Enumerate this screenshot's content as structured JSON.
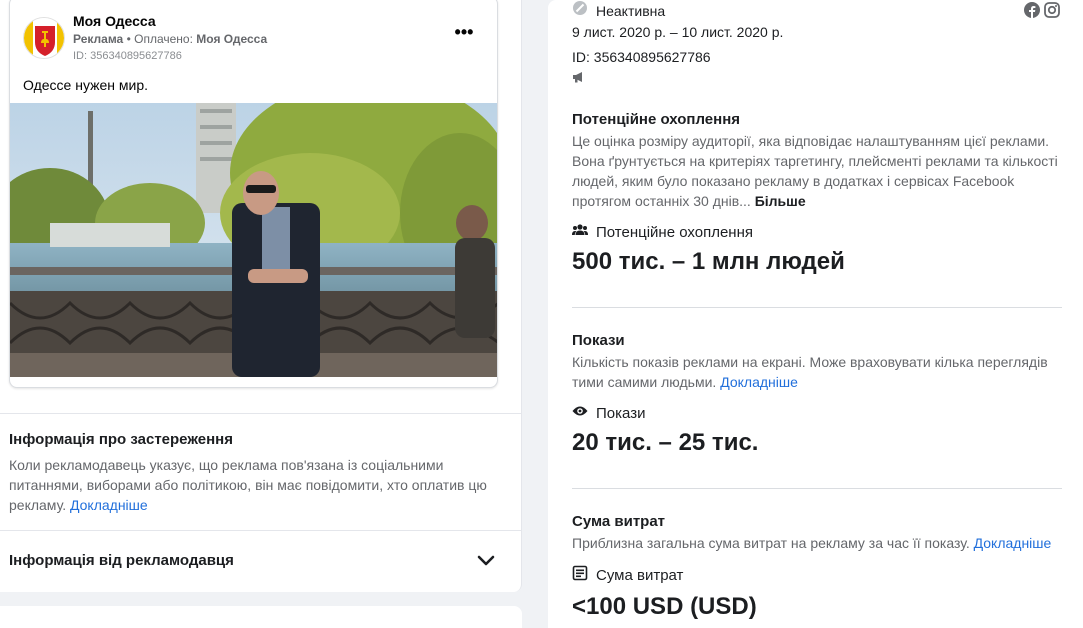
{
  "ad": {
    "page_name": "Моя Одесса",
    "sponsored_label": "Реклама",
    "paid_by_prefix": "Оплачено:",
    "paid_by_name": "Моя Одесса",
    "ad_id_small": "ID: 356340895627786",
    "body_text": "Одессе нужен мир.",
    "more_options_glyph": "•••"
  },
  "disclaimer": {
    "title": "Інформація про застереження",
    "description": "Коли рекламодавець указує, що реклама пов'язана із соціальними питаннями, виборами або політикою, він має повідомити, хто оплатив цю рекламу.",
    "learn_more": "Докладніше"
  },
  "advertiser": {
    "title": "Інформація від рекламодавця"
  },
  "details": {
    "status": "Неактивна",
    "date_range": "9 лист. 2020 р. – 10 лист. 2020 р.",
    "ad_id": "ID: 356340895627786"
  },
  "reach": {
    "title": "Потенційне охоплення",
    "description": "Це оцінка розміру аудиторії, яка відповідає налаштуванням цієї реклами. Вона ґрунтується на критеріях таргетингу, плейсменті реклами та кількості людей, яким було показано рекламу в додатках і сервісах Facebook протягом останніх 30 днів...",
    "more_link": "Більше",
    "label": "Потенційне охоплення",
    "value": "500 тис. – 1 млн людей"
  },
  "impressions": {
    "title": "Покази",
    "description": "Кількість показів реклами на екрані. Може враховувати кілька переглядів тими самими людьми.",
    "learn_more": "Докладніше",
    "label": "Покази",
    "value": "20 тис. – 25 тис."
  },
  "spend": {
    "title": "Сума витрат",
    "description": "Приблизна загальна сума витрат на рекламу за час її показу.",
    "learn_more": "Докладніше",
    "label": "Сума витрат",
    "value": "<100 USD (USD)"
  },
  "icons": {
    "status": "slash-circle-icon",
    "megaphone": "megaphone-icon",
    "people": "people-icon",
    "eye": "eye-icon",
    "receipt": "receipt-icon",
    "facebook": "facebook-icon",
    "instagram": "instagram-icon",
    "chevron": "chevron-down-icon"
  },
  "colors": {
    "link": "#216fdb",
    "secondary_text": "#65676b",
    "background": "#f0f2f5"
  }
}
